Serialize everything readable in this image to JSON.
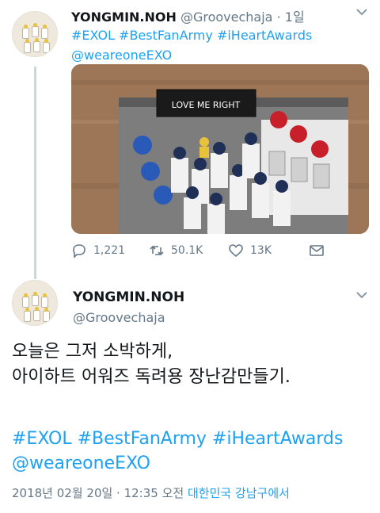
{
  "tweet1": {
    "display_name": "YONGMIN.NOH",
    "handle": "@Groovechaja",
    "separator": "·",
    "time": "1일",
    "text_line1": "#EXOL #BestFanArmy #iHeartAwards",
    "text_line2": "@weareoneEXO",
    "media_sign": "LOVE ME RIGHT",
    "actions": {
      "reply_count": "1,221",
      "retweet_count": "50.1K",
      "like_count": "13K"
    }
  },
  "tweet2": {
    "display_name": "YONGMIN.NOH",
    "handle": "@Groovechaja",
    "body_line1": "오늘은 그저 소박하게,",
    "body_line2": "아이하트 어워즈 독려용 장난감만들기.",
    "tags_line1": "#EXOL #BestFanArmy #iHeartAwards",
    "tags_line2": "@weareoneEXO",
    "datetime": "2018년 02월 20일 · 12:35 오전",
    "location": "대한민국 강남구에서"
  },
  "icons": [
    "reply-icon",
    "retweet-icon",
    "like-icon",
    "share-icon",
    "chevron-down-icon"
  ],
  "colors": {
    "link": "#1da1f2",
    "muted": "#657786",
    "text": "#14171a",
    "thread_line": "#ccd6dd"
  }
}
